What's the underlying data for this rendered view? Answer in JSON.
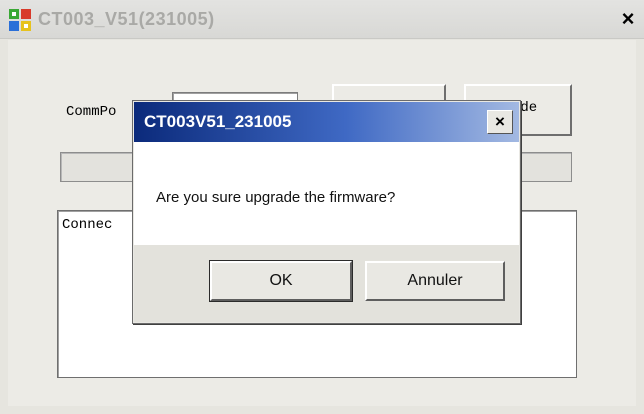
{
  "main_window": {
    "title": "CT003_V51(231005)",
    "close_symbol": "×",
    "icon": "app-grid-icon",
    "commport_label": "CommPo",
    "button_partial_label": "ade",
    "log_text": "Connec"
  },
  "dialog": {
    "title": "CT003V51_231005",
    "close_symbol": "×",
    "message": "Are you sure upgrade the firmware?",
    "ok_label": "OK",
    "cancel_label": "Annuler"
  },
  "colors": {
    "dialog_title_start": "#0b2a7b",
    "dialog_title_end": "#a3b9e2",
    "window_bg": "#ecebe6"
  }
}
